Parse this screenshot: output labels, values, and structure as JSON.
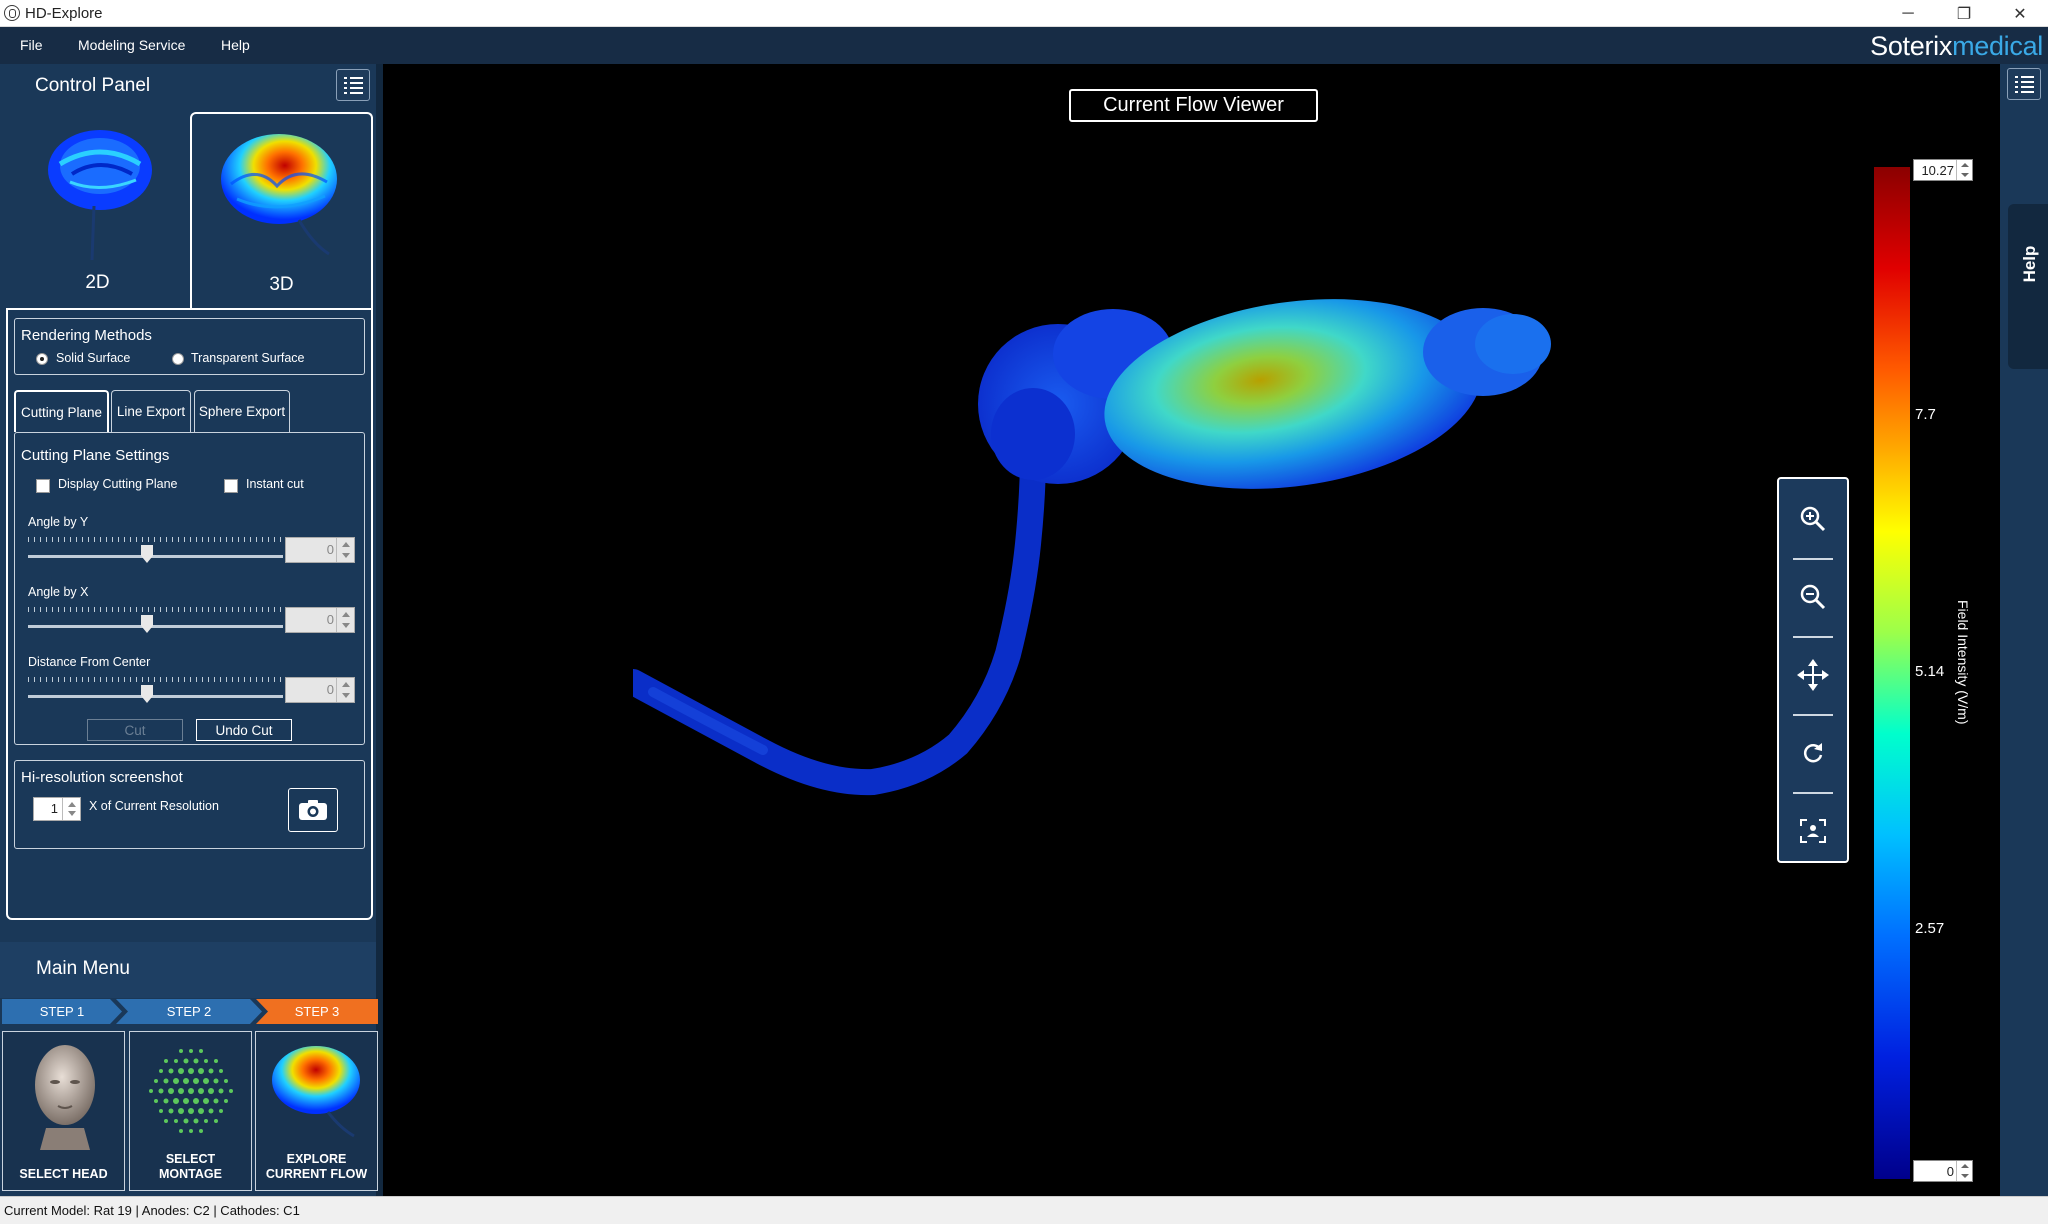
{
  "window": {
    "title": "HD-Explore",
    "min_glyph": "─",
    "max_glyph": "❐",
    "close_glyph": "✕"
  },
  "menubar": {
    "items": [
      "File",
      "Modeling Service",
      "Help"
    ],
    "brand_part1": "Soterix",
    "brand_part2": "medical"
  },
  "control_panel": {
    "title": "Control Panel",
    "view_tabs": [
      {
        "label": "2D"
      },
      {
        "label": "3D"
      }
    ],
    "rendering": {
      "title": "Rendering Methods",
      "options": [
        "Solid Surface",
        "Transparent Surface"
      ],
      "selected": "Solid Surface"
    },
    "subtabs": [
      "Cutting Plane",
      "Line Export",
      "Sphere Export"
    ],
    "cutting": {
      "title": "Cutting Plane Settings",
      "display_plane_label": "Display Cutting Plane",
      "instant_cut_label": "Instant cut",
      "angle_y": {
        "label": "Angle by Y",
        "value": "0"
      },
      "angle_x": {
        "label": "Angle by X",
        "value": "0"
      },
      "distance": {
        "label": "Distance From Center",
        "value": "0"
      },
      "cut_label": "Cut",
      "undo_label": "Undo Cut"
    },
    "screenshot": {
      "title": "Hi-resolution screenshot",
      "factor": "1",
      "factor_label": "X of Current Resolution"
    }
  },
  "main_menu": {
    "title": "Main Menu",
    "steps": [
      "STEP 1",
      "STEP 2",
      "STEP 3"
    ],
    "cards": [
      {
        "caption": "SELECT HEAD"
      },
      {
        "caption_l1": "SELECT",
        "caption_l2": "MONTAGE"
      },
      {
        "caption_l1": "EXPLORE",
        "caption_l2": "CURRENT FLOW"
      }
    ]
  },
  "viewer": {
    "title": "Current Flow Viewer",
    "tools": [
      "zoom-in-icon",
      "zoom-out-icon",
      "pan-icon",
      "reset-icon",
      "screenshot-icon"
    ]
  },
  "colorbar": {
    "max": "10.27",
    "min": "0",
    "ticks": [
      "7.7",
      "5.14",
      "2.57"
    ],
    "title": "Field Intensity (V/m)",
    "colors": [
      "#8b0000",
      "#ff0000",
      "#ffaa00",
      "#ffff00",
      "#00ffcc",
      "#0070ff",
      "#00008b"
    ]
  },
  "help": {
    "label": "Help"
  },
  "status": {
    "text": "Current Model: Rat 19  |  Anodes: C2  |  Cathodes: C1"
  }
}
